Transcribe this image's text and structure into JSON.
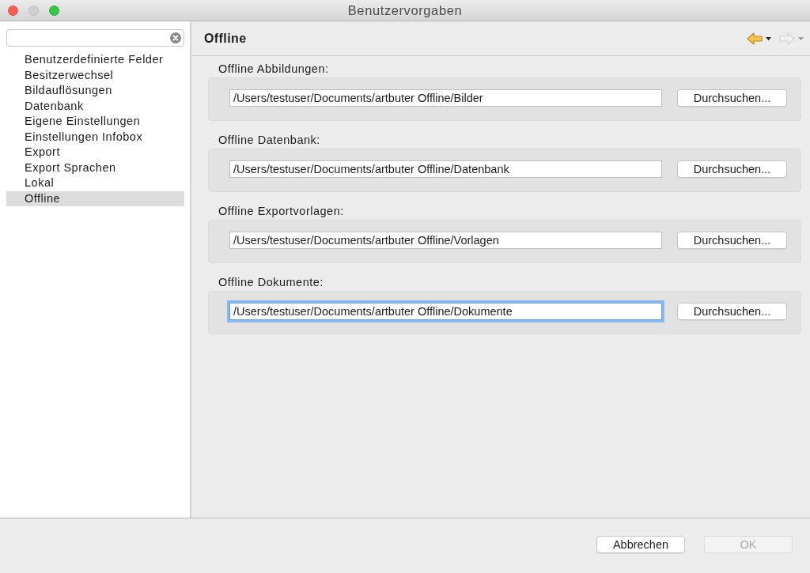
{
  "window": {
    "title": "Benutzervorgaben",
    "controls": [
      {
        "kind": "close",
        "disabled": false
      },
      {
        "kind": "minimize",
        "disabled": true
      },
      {
        "kind": "zoom",
        "disabled": false
      }
    ]
  },
  "sidebar": {
    "items": [
      {
        "label": "Benutzerdefinierte Felder",
        "selected": false
      },
      {
        "label": "Besitzerwechsel",
        "selected": false
      },
      {
        "label": "Bildauflösungen",
        "selected": false
      },
      {
        "label": "Datenbank",
        "selected": false
      },
      {
        "label": "Eigene Einstellungen",
        "selected": false
      },
      {
        "label": "Einstellungen Infobox",
        "selected": false
      },
      {
        "label": "Export",
        "selected": false
      },
      {
        "label": "Export Sprachen",
        "selected": false
      },
      {
        "label": "Lokal",
        "selected": false
      },
      {
        "label": "Offline",
        "selected": true
      }
    ]
  },
  "page": {
    "title": "Offline",
    "nav": [
      {
        "kind": "back",
        "disabled": false
      },
      {
        "kind": "forward",
        "disabled": true
      }
    ],
    "groups": [
      {
        "label": "Offline Abbildungen:",
        "path": "/Users/testuser/Documents/artbuter Offline/Bilder",
        "focused": false,
        "button": "Durchsuchen..."
      },
      {
        "label": "Offline Datenbank:",
        "path": "/Users/testuser/Documents/artbuter Offline/Datenbank",
        "focused": false,
        "button": "Durchsuchen..."
      },
      {
        "label": "Offline Exportvorlagen:",
        "path": "/Users/testuser/Documents/artbuter Offline/Vorlagen",
        "focused": false,
        "button": "Durchsuchen..."
      },
      {
        "label": "Offline Dokumente:",
        "path": "/Users/testuser/Documents/artbuter Offline/Dokumente",
        "focused": true,
        "button": "Durchsuchen..."
      }
    ]
  },
  "buttons": [
    {
      "label": "Abbrechen",
      "disabled": false
    },
    {
      "label": "OK",
      "disabled": true
    }
  ]
}
